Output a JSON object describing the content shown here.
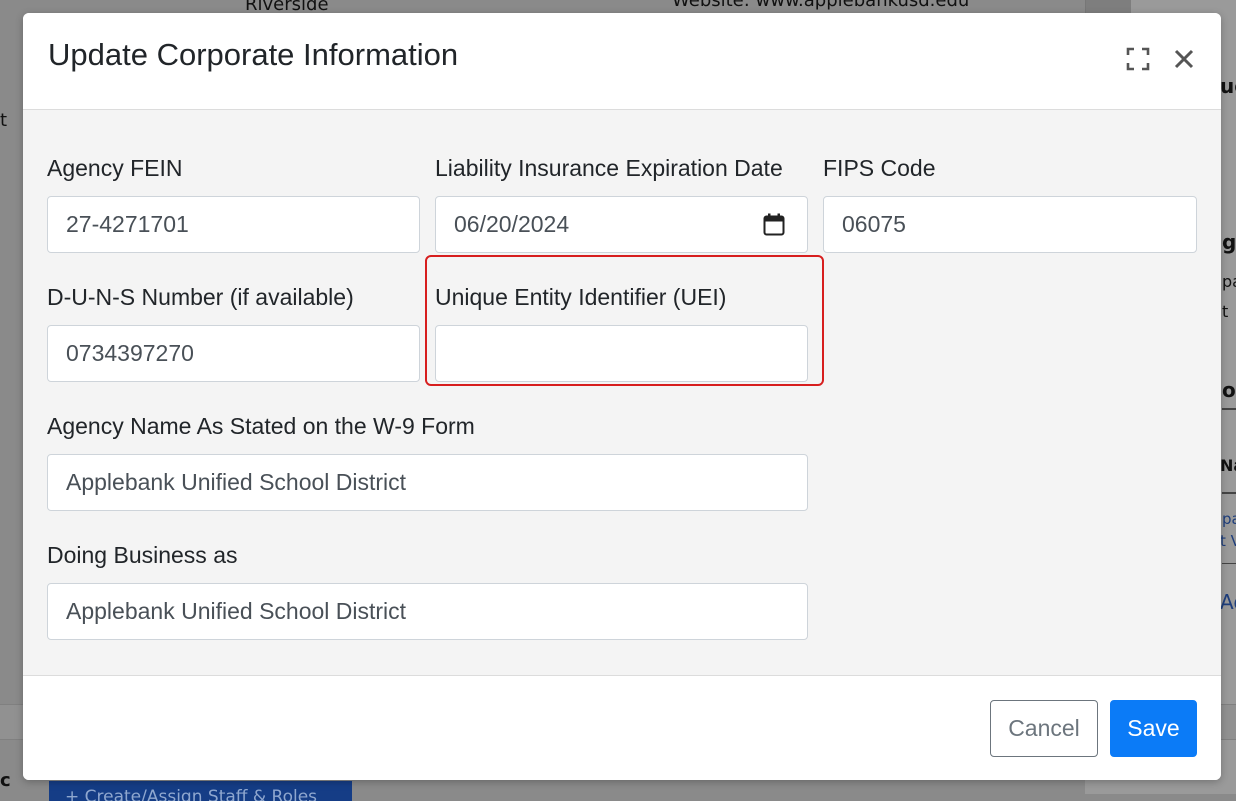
{
  "background": {
    "top_left_text": "Riverside",
    "top_center_text": "Website: www.applebankusd.edu",
    "left_edge_char": "t",
    "right_fragments": [
      "ue",
      "g",
      "pa",
      "t",
      "on",
      "Na",
      "pa",
      "t V",
      "Ad"
    ],
    "bottom_left_char": "c",
    "bottom_button_label": "+ Create/Assign Staff & Roles"
  },
  "modal": {
    "title": "Update Corporate Information",
    "expand_icon": "expand-icon",
    "close_icon": "close-icon",
    "fields": {
      "fein": {
        "label": "Agency FEIN",
        "value": "27-4271701"
      },
      "insurance_date": {
        "label": "Liability Insurance Expiration Date",
        "value": "06/20/2024",
        "icon": "calendar-icon"
      },
      "fips": {
        "label": "FIPS Code",
        "value": "06075"
      },
      "duns": {
        "label": "D-U-N-S Number (if available)",
        "value": "0734397270"
      },
      "uei": {
        "label": "Unique Entity Identifier (UEI)",
        "value": ""
      },
      "w9_name": {
        "label": "Agency Name As Stated on the W-9 Form",
        "value": "Applebank Unified School District"
      },
      "dba": {
        "label": "Doing Business as",
        "value": "Applebank Unified School District"
      }
    },
    "footer": {
      "cancel_label": "Cancel",
      "save_label": "Save"
    },
    "colors": {
      "primary": "#0b7bf7",
      "highlight": "#d71e1e",
      "muted": "#6c757d"
    }
  }
}
